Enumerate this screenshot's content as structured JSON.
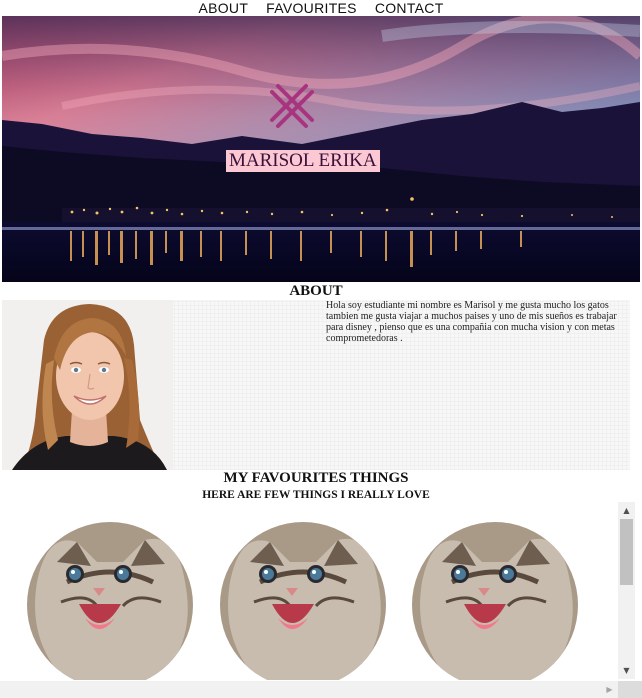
{
  "nav": {
    "items": [
      {
        "label": "ABOUT"
      },
      {
        "label": "FAVOURITES"
      },
      {
        "label": "CONTACT"
      }
    ]
  },
  "hero": {
    "name": "MARISOL ERIKA",
    "logo_icon": "cross-pattern-logo-icon",
    "logo_color": "#a8347f"
  },
  "about": {
    "title": "ABOUT",
    "text": "Hola soy estudiante mi nombre es Marisol y me gusta mucho los gatos tambien me gusta viajar a muchos paises y uno de mis sueños es trabajar para disney , pienso que es una compañia con mucha vision y con metas comprometedoras ."
  },
  "favourites": {
    "title": "MY FAVOURITES THINGS",
    "subtitle": "HERE ARE FEW THINGS I REALLY LOVE"
  },
  "scrollbar": {
    "up_glyph": "▲",
    "down_glyph": "▼",
    "right_glyph": "▶"
  }
}
